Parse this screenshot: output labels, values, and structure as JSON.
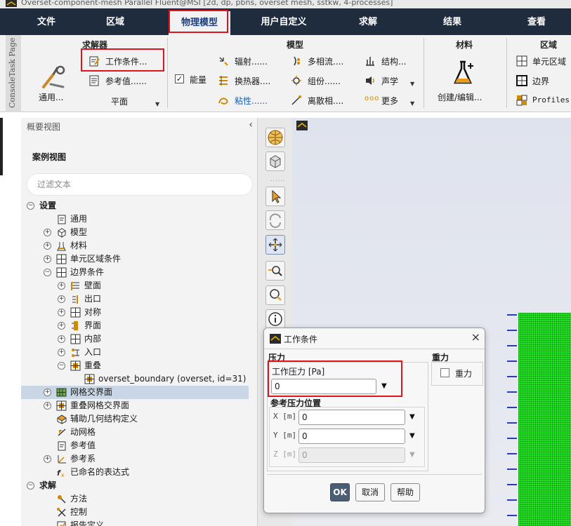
{
  "window": {
    "title": "Overset-component-mesh Parallel Fluent@MSI  [2d, dp, pbns, overset mesh, sstkw, 4-processes]"
  },
  "menu_tabs": [
    "文件",
    "区域",
    "物理模型",
    "用户自定义",
    "求解",
    "结果",
    "查看"
  ],
  "ribbon": {
    "vertical_strip": "ConsoleTask Page",
    "solver": {
      "title": "求解器",
      "general": "通用...",
      "operating_conditions": "工作条件...",
      "reference_values": "参考值......",
      "plane": "平面"
    },
    "models": {
      "title": "模型",
      "energy": "能量",
      "energy_checked": true,
      "radiation": "辐射......",
      "heat_exchanger": "换热器....",
      "viscous": "粘性......",
      "multiphase": "多相流....",
      "species": "组份......",
      "discrete_phase": "离散相....",
      "structure": "结构...",
      "acoustics": "声学",
      "more": "更多"
    },
    "materials": {
      "title": "材料",
      "create_edit": "创建/编辑..."
    },
    "zones": {
      "title": "区域",
      "cell_zones": "单元区域",
      "boundaries": "边界",
      "profiles": "Profiles..."
    }
  },
  "outline": {
    "title": "概要视图",
    "case_view": "案例视图",
    "filter_placeholder": "过滤文本",
    "tree": [
      {
        "label": "设置",
        "expander": "−"
      },
      {
        "label": "通用"
      },
      {
        "label": "模型",
        "expander": "+"
      },
      {
        "label": "材料",
        "expander": "+"
      },
      {
        "label": "单元区域条件",
        "expander": "+"
      },
      {
        "label": "边界条件",
        "expander": "−"
      },
      {
        "label": "壁面",
        "expander": "+"
      },
      {
        "label": "出口",
        "expander": "+"
      },
      {
        "label": "对称",
        "expander": "+"
      },
      {
        "label": "界面",
        "expander": "+"
      },
      {
        "label": "内部",
        "expander": "+"
      },
      {
        "label": "入口",
        "expander": "+"
      },
      {
        "label": "重叠",
        "expander": "−"
      },
      {
        "label": "overset_boundary (overset, id=31)"
      },
      {
        "label": "网格交界面",
        "expander": "+"
      },
      {
        "label": "重叠网格交界面",
        "expander": "+"
      },
      {
        "label": "辅助几何结构定义"
      },
      {
        "label": "动网格"
      },
      {
        "label": "参考值"
      },
      {
        "label": "参考系",
        "expander": "+"
      },
      {
        "label": "已命名的表达式"
      },
      {
        "label": "求解",
        "expander": "−"
      },
      {
        "label": "方法"
      },
      {
        "label": "控制"
      },
      {
        "label": "报告定义"
      }
    ]
  },
  "dialog": {
    "title": "工作条件",
    "pressure_section": "压力",
    "operating_pressure_label": "工作压力 [Pa]",
    "operating_pressure_value": "0",
    "reference_location_label": "参考压力位置",
    "x_label": "X [m]",
    "x_value": "0",
    "y_label": "Y [m]",
    "y_value": "0",
    "z_label": "Z [m]",
    "z_value": "0",
    "gravity_section": "重力",
    "gravity_checkbox": "重力",
    "gravity_checked": false,
    "ok": "OK",
    "cancel": "取消",
    "help": "帮助"
  }
}
